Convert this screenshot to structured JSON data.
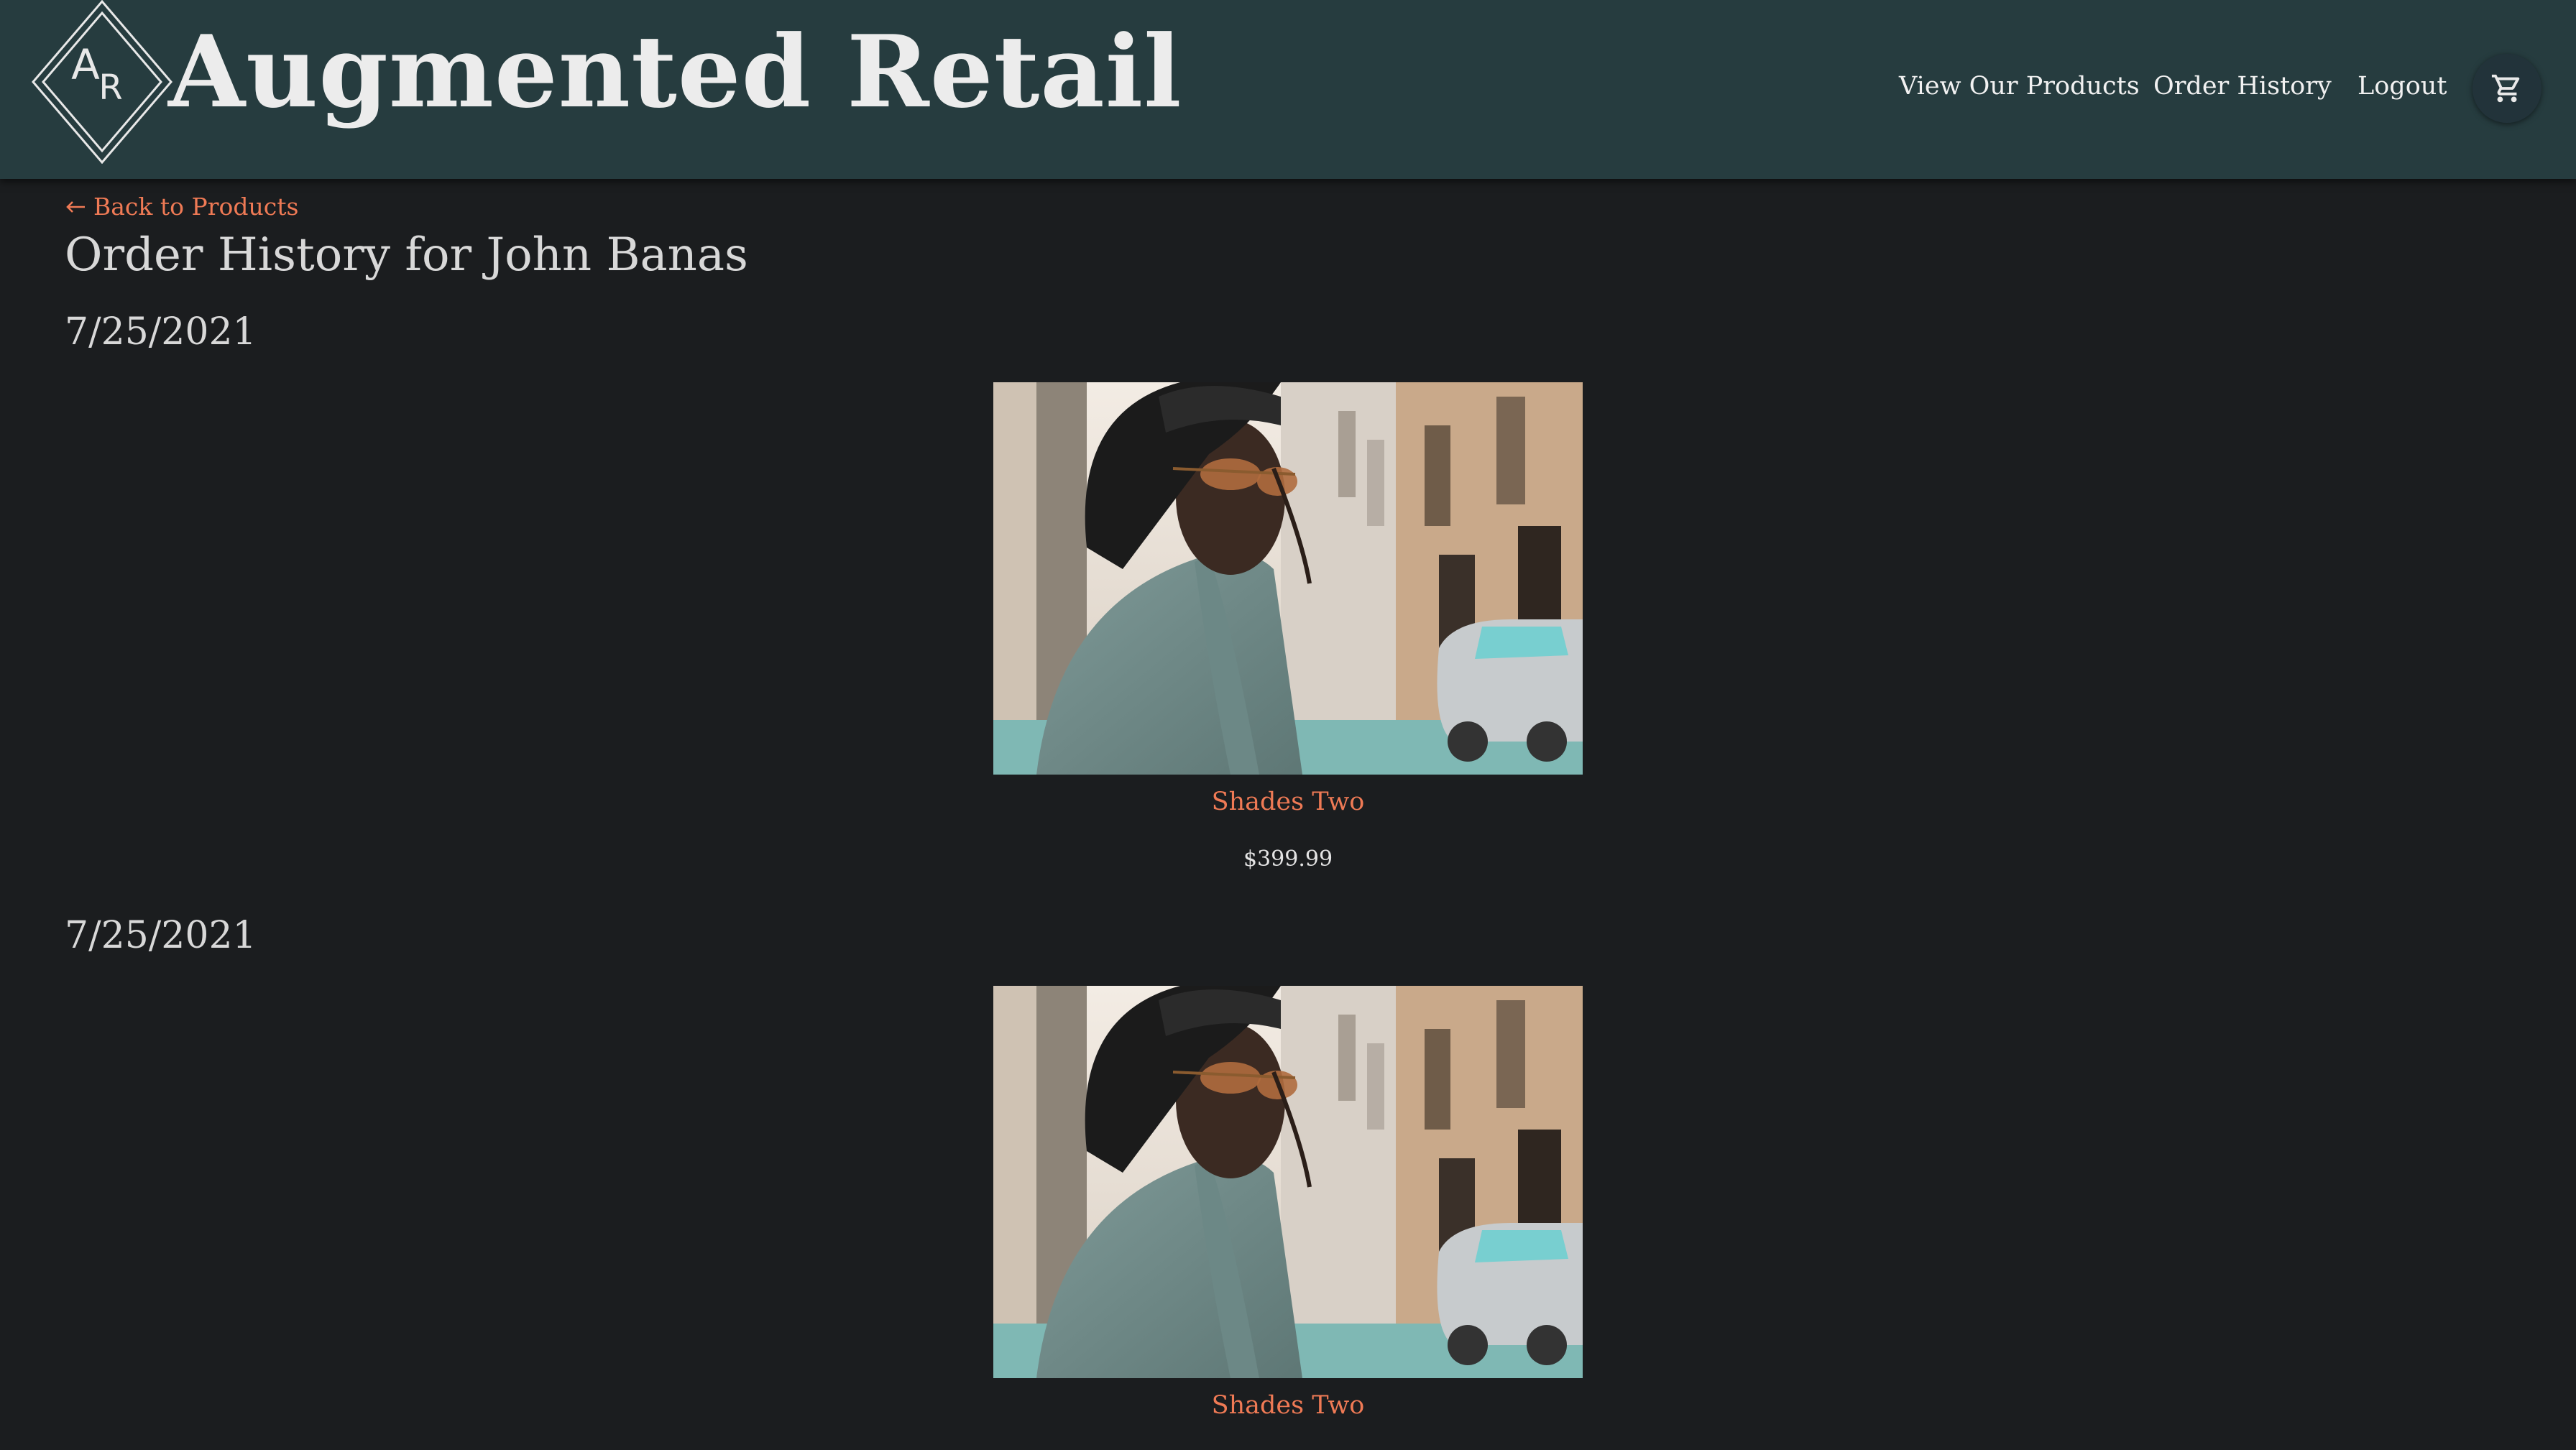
{
  "brand": {
    "logo_letters": "AR",
    "title": "Augmented Retail"
  },
  "nav": {
    "items": [
      {
        "label": "View Our Products"
      },
      {
        "label": "Order History"
      },
      {
        "label": "Logout"
      }
    ],
    "cart_icon": "shopping-cart-icon"
  },
  "back_link": {
    "arrow_icon": "arrow-left-icon",
    "label": "Back to Products"
  },
  "page_title": "Order History for John Banas",
  "orders": [
    {
      "date": "7/25/2021",
      "items": [
        {
          "name": "Shades Two",
          "price": "$399.99"
        }
      ]
    },
    {
      "date": "7/25/2021",
      "items": [
        {
          "name": "Shades Two"
        }
      ]
    }
  ],
  "colors": {
    "header_bg": "#263c3f",
    "page_bg": "#1b1d1f",
    "accent": "#ef7a55",
    "text": "#d8d8d8"
  }
}
